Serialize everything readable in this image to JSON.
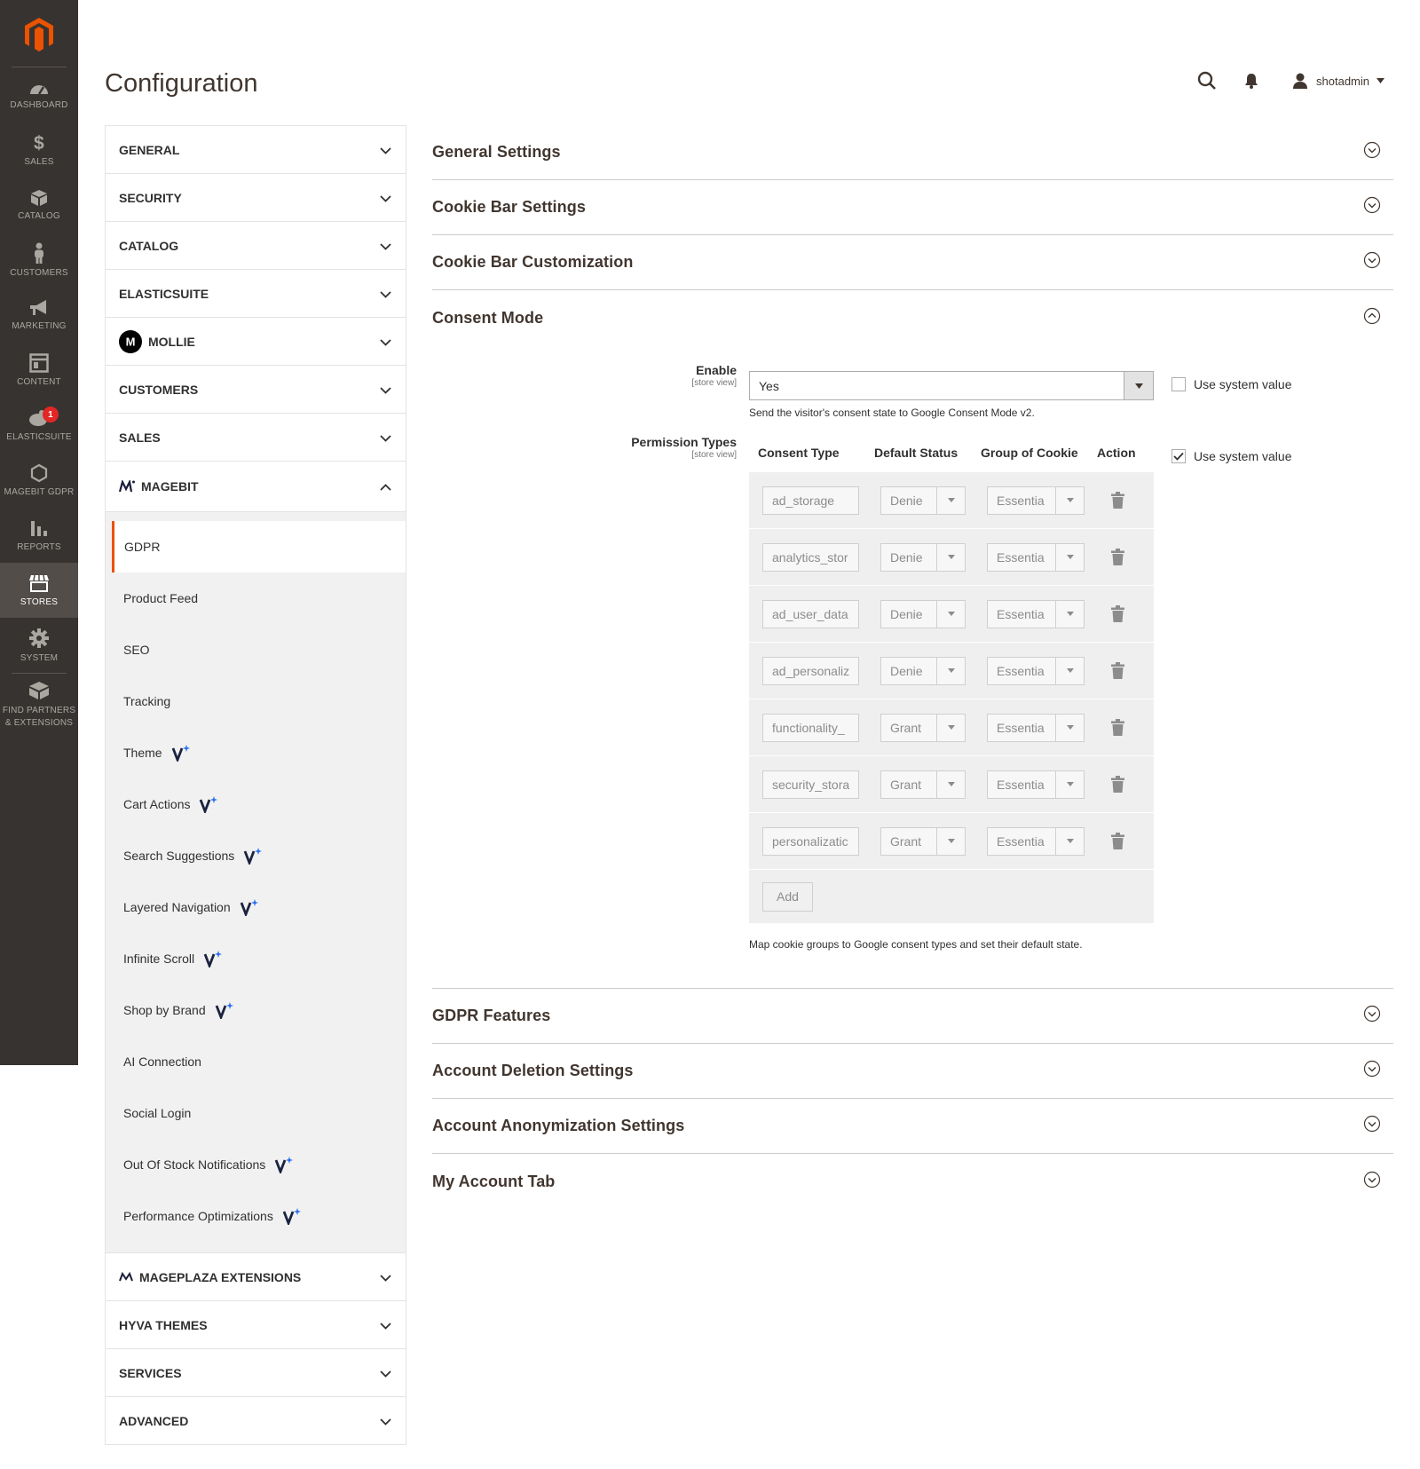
{
  "admin_menu": {
    "items": [
      {
        "label": "Dashboard",
        "icon": "dashboard-icon"
      },
      {
        "label": "Sales",
        "icon": "dollar-icon"
      },
      {
        "label": "Catalog",
        "icon": "box-icon"
      },
      {
        "label": "Customers",
        "icon": "person-icon"
      },
      {
        "label": "Marketing",
        "icon": "megaphone-icon"
      },
      {
        "label": "Content",
        "icon": "layout-icon"
      },
      {
        "label": "Elasticsuite",
        "icon": "elasticsuite-icon",
        "badge": "1"
      },
      {
        "label": "Magebit GDPR",
        "icon": "hexagon-icon"
      },
      {
        "label": "Reports",
        "icon": "bar-chart-icon"
      },
      {
        "label": "Stores",
        "icon": "store-icon",
        "active": true
      },
      {
        "label": "System",
        "icon": "gear-icon"
      }
    ],
    "partners_line1": "Find Partners",
    "partners_line2": "& Extensions"
  },
  "header": {
    "title": "Configuration",
    "username": "shotadmin"
  },
  "config_tabs": {
    "general": "GENERAL",
    "security": "SECURITY",
    "catalog": "CATALOG",
    "elasticsuite": "ELASTICSUITE",
    "mollie": "MOLLIE",
    "customers": "CUSTOMERS",
    "sales": "SALES",
    "magebit": "MAGEBIT",
    "magebit_items": [
      {
        "label": "GDPR",
        "active": true
      },
      {
        "label": "Product Feed"
      },
      {
        "label": "SEO"
      },
      {
        "label": "Tracking"
      },
      {
        "label": "Theme",
        "v_badge": true
      },
      {
        "label": "Cart Actions",
        "v_badge": true
      },
      {
        "label": "Search Suggestions",
        "v_badge": true
      },
      {
        "label": "Layered Navigation",
        "v_badge": true
      },
      {
        "label": "Infinite Scroll",
        "v_badge": true
      },
      {
        "label": "Shop by Brand",
        "v_badge": true
      },
      {
        "label": "AI Connection"
      },
      {
        "label": "Social Login"
      },
      {
        "label": "Out Of Stock Notifications",
        "v_badge": true
      },
      {
        "label": "Performance Optimizations",
        "v_badge": true
      }
    ],
    "mageplaza": "MAGEPLAZA EXTENSIONS",
    "hyva": "HYVA THEMES",
    "services": "SERVICES",
    "advanced": "ADVANCED"
  },
  "sections": {
    "general_settings": "General Settings",
    "cookie_bar_settings": "Cookie Bar Settings",
    "cookie_bar_customization": "Cookie Bar Customization",
    "consent_mode": "Consent Mode",
    "gdpr_features": "GDPR Features",
    "account_deletion": "Account Deletion Settings",
    "account_anonymization": "Account Anonymization Settings",
    "my_account_tab": "My Account Tab"
  },
  "consent_mode": {
    "enable_label": "Enable",
    "enable_scope": "[store view]",
    "enable_value": "Yes",
    "enable_note": "Send the visitor's consent state to Google Consent Mode v2.",
    "use_system_value": "Use system value",
    "enable_use_system_checked": false,
    "perm_label": "Permission Types",
    "perm_scope": "[store view]",
    "perm_use_system_checked": true,
    "columns": [
      "Consent Type",
      "Default Status",
      "Group of Cookie",
      "Action"
    ],
    "rows": [
      {
        "consent_type": "ad_storage",
        "status": "Denie",
        "group": "Essentia"
      },
      {
        "consent_type": "analytics_stor",
        "status": "Denie",
        "group": "Essentia"
      },
      {
        "consent_type": "ad_user_data",
        "status": "Denie",
        "group": "Essentia"
      },
      {
        "consent_type": "ad_personaliz",
        "status": "Denie",
        "group": "Essentia"
      },
      {
        "consent_type": "functionality_",
        "status": "Grant",
        "group": "Essentia"
      },
      {
        "consent_type": "security_stora",
        "status": "Grant",
        "group": "Essentia"
      },
      {
        "consent_type": "personalizatic",
        "status": "Grant",
        "group": "Essentia"
      }
    ],
    "add_button": "Add",
    "perm_note": "Map cookie groups to Google consent types and set their default state."
  },
  "colors": {
    "menu_bg": "#373330",
    "accent": "#eb5202",
    "badge": "#e22626"
  }
}
